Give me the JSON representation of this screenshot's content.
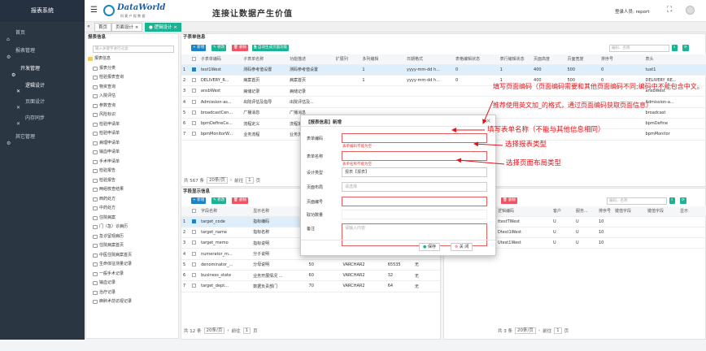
{
  "sidebar": {
    "title": "报表系统",
    "items": [
      {
        "label": "首页"
      },
      {
        "label": "报表管理"
      },
      {
        "label": "开发管理"
      },
      {
        "label": "逻辑设计"
      },
      {
        "label": "页面设计"
      },
      {
        "label": "内存同步"
      },
      {
        "label": "其它管理"
      }
    ]
  },
  "header": {
    "logo_main": "DataWorld",
    "logo_sub": "科 菱 户 报 数 据",
    "slogan": "连接让数据产生价值",
    "user_label": "登录人员: report"
  },
  "tabs": [
    {
      "label": "首页"
    },
    {
      "label": "页面设计 ×"
    },
    {
      "label": "● 逻辑设计 ×"
    }
  ],
  "tree": {
    "title": "报表信息",
    "search_placeholder": "输入关键字进行过滤",
    "root": "报表信息",
    "items": [
      "报表分类",
      "检验报表查询",
      "物资查询",
      "入院评估",
      "参数查询",
      "风险标识",
      "检验申请单",
      "检验申请单",
      "病理申请单",
      "输血申请单",
      "手术申请单",
      "检验报告",
      "检验报告",
      "两组核查结果",
      "西药处方",
      "中药处方",
      "住院病案",
      "门（急）诊病历",
      "急诊留观病历",
      "住院病案首页",
      "中医住院病案首页",
      "生命体征测量记录",
      "一般手术记录",
      "输血记录",
      "治疗记录",
      "麻醉术前访视记录"
    ]
  },
  "sub_table": {
    "title": "子表单信息",
    "buttons": [
      "+ 新增",
      "✎ 修改",
      "🗑 删除",
      "🗎 自动生成页面功能"
    ],
    "search_placeholder": "编码、名称",
    "columns": [
      "子表单编码",
      "子表单名称",
      "功能描述",
      "扩展列",
      "多列编辑",
      "日期格式",
      "表格编辑状态",
      "表行编辑状态",
      "页面高度",
      "页面宽度",
      "排序号",
      "表头"
    ],
    "rows": [
      [
        "test1West",
        "测码参考值设置",
        "测码参考值设置",
        "",
        "1",
        "yyyy-mm-dd h...",
        "0",
        "1",
        "400",
        "500",
        "0",
        "tust1"
      ],
      [
        "DELIVERY_R...",
        "病案首页",
        "病案首页",
        "",
        "1",
        "yyyy-mm-dd h...",
        "0",
        "1",
        "400",
        "500",
        "0",
        "DELIVERY_RE..."
      ],
      [
        "ansbWest",
        "病储记录",
        "病储记录",
        "",
        "",
        "",
        "",
        "",
        "",
        "",
        "",
        "ansbWest"
      ],
      [
        "Admission-as...",
        "出院评估及指导",
        "出院评估及...",
        "",
        "",
        "",
        "",
        "",
        "",
        "",
        "",
        "Admission-a..."
      ],
      [
        "broadcastCen...",
        "广播消息",
        "广播消息",
        "",
        "",
        "",
        "",
        "",
        "",
        "",
        "",
        "broadcast"
      ],
      [
        "bpmDefineCe...",
        "流程定义",
        "流程定义",
        "",
        "",
        "",
        "",
        "",
        "",
        "",
        "",
        "bpmDefine"
      ],
      [
        "bpmMonitorW...",
        "业务流程",
        "业务流程",
        "",
        "",
        "",
        "",
        "",
        "",
        "",
        "",
        "bpmMonitor"
      ]
    ],
    "pager": {
      "total": "共 567 条",
      "size": "20条/页",
      "goto": "前往",
      "page": "1",
      "unit": "页"
    }
  },
  "field_table": {
    "title": "字段显示信息",
    "buttons": [
      "+ 新增",
      "✎ 修改",
      "🗑 删除"
    ],
    "columns": [
      "字段名称",
      "显示名称",
      "列宽",
      "数据类型",
      "数据长度",
      "允许空"
    ],
    "rows": [
      [
        "target_code",
        "指标编码",
        "",
        "",
        "",
        ""
      ],
      [
        "target_name",
        "指标名称",
        "",
        "",
        "",
        ""
      ],
      [
        "target_memo",
        "指标说明",
        "",
        "",
        "",
        ""
      ],
      [
        "numerator_m...",
        "分子说明",
        "40",
        "VARCHAR2",
        "65535",
        "无"
      ],
      [
        "denominator_...",
        "分母说明",
        "50",
        "VARCHAR2",
        "65535",
        "无"
      ],
      [
        "business_state",
        "业务开展情况 ...",
        "60",
        "VARCHAR2",
        "32",
        "无"
      ],
      [
        "target_dept...",
        "数据负责部门",
        "70",
        "VARCHAR2",
        "64",
        "无"
      ]
    ],
    "pager": {
      "total": "共 12 条",
      "size": "20条/页",
      "goto": "前往",
      "page": "1",
      "unit": "页"
    }
  },
  "logic_table": {
    "buttons": [
      "+ 新增",
      "✎ 修改",
      "🗑 删除"
    ],
    "search_placeholder": "编码、名称",
    "columns": [
      "逻辑编码",
      "客户",
      "服务...",
      "排序号",
      "键值字段",
      "键值字段",
      "显示"
    ],
    "rows": [
      [
        "ttestTWest",
        "U",
        "U",
        "10",
        "",
        "",
        ""
      ],
      [
        "Dtest1West",
        "U",
        "U",
        "10",
        "",
        "",
        ""
      ],
      [
        "Utest1West",
        "U",
        "U",
        "10",
        "",
        "",
        ""
      ]
    ],
    "pager": {
      "total": "共 3 条",
      "size": "20条/页",
      "goto": "前往",
      "page": "1",
      "unit": "页"
    }
  },
  "dialog": {
    "title": "【报表信息】新增",
    "fields": [
      {
        "label": "表单编码",
        "value": "",
        "error": "表单编码不能为空"
      },
      {
        "label": "表单名称",
        "value": "",
        "error": "表单名称不能为空"
      },
      {
        "label": "设计类型",
        "value": "报表【报表】"
      },
      {
        "label": "页面布局",
        "value": "请选择"
      },
      {
        "label": "页面编号",
        "value": ""
      },
      {
        "label": "取功数量",
        "value": ""
      },
      {
        "label": "备注",
        "value": "请输入内容"
      }
    ],
    "save": "保存",
    "close": "关 闭"
  },
  "annotations": [
    "填写页面编码（页面编码需要和其他页面编码不同;编码中不能包含中文。",
    "推荐使用英文加_的格式，通过页面编码获取页面信息）",
    "填写表单名称（不能与其他信息相同）",
    "选择报表类型",
    "选择页面布局类型"
  ],
  "colors": {
    "sidebar": "#2b3643",
    "accent": "#1ab394",
    "primary": "#1c84c6",
    "danger": "#ed5565",
    "annotation": "#e3141b"
  }
}
